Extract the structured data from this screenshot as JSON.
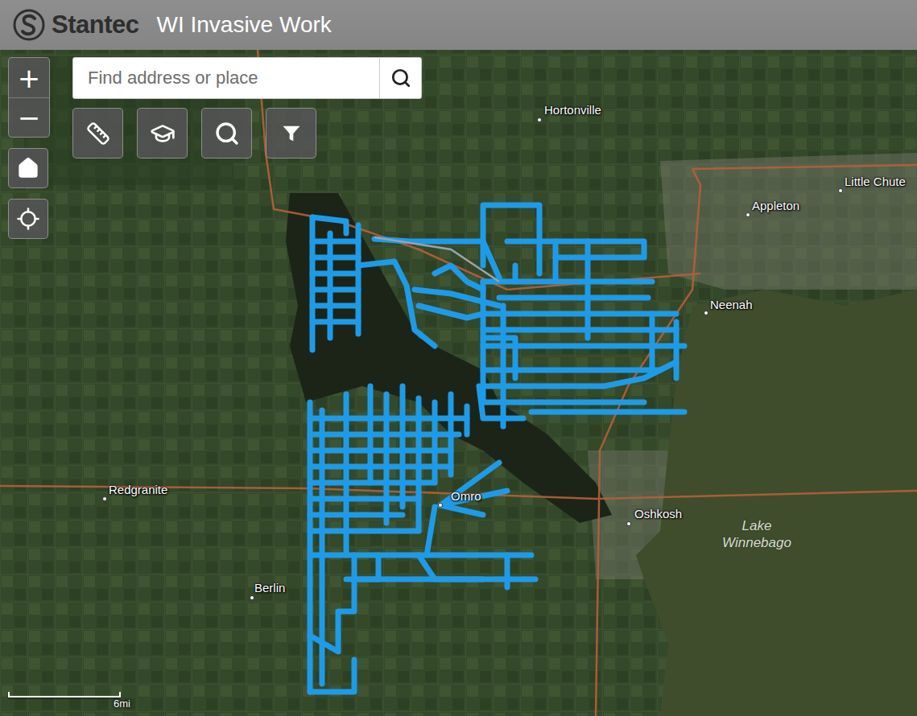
{
  "header": {
    "logo": "Stantec",
    "title": "WI Invasive Work"
  },
  "search": {
    "placeholder": "Find address or place"
  },
  "zoom": {
    "in": "+",
    "out": "−"
  },
  "places": [
    {
      "name": "Hortonville"
    },
    {
      "name": "Appleton"
    },
    {
      "name": "Little Chute"
    },
    {
      "name": "Neenah"
    },
    {
      "name": "Redgranite"
    },
    {
      "name": "Omro"
    },
    {
      "name": "Oshkosh"
    },
    {
      "name": "Berlin"
    }
  ],
  "water_labels": [
    {
      "name": "Lake Winnebago"
    }
  ],
  "scale": {
    "label": "6mi"
  }
}
